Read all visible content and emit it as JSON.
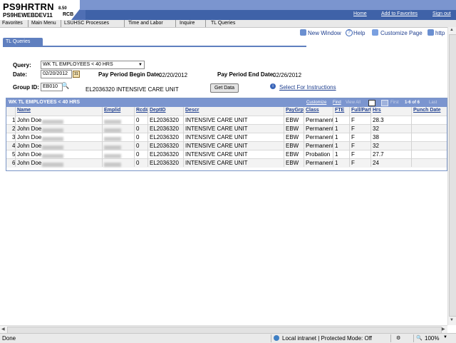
{
  "header": {
    "app_title": "PS9HRTRN",
    "app_version": "8.50",
    "db_name": "PS9HEWEBDEV11",
    "user_id": "RCB",
    "links": [
      "Home",
      "Add to Favorites",
      "Sign out"
    ]
  },
  "nav": {
    "items": [
      "Favorites",
      "Main Menu",
      "LSUHSC Processes",
      "Time and Labor",
      "Inquire",
      "TL Queries"
    ]
  },
  "toolbar": {
    "new_window": "New Window",
    "help": "Help",
    "customize_page": "Customize Page",
    "http": "http"
  },
  "tab": {
    "label": "TL Queries"
  },
  "form": {
    "query_label": "Query:",
    "query_value": "WK TL EMPLOYEES < 40 HRS",
    "date_label": "Date:",
    "date_value": "02/20/2012",
    "calendar_label": "31",
    "begin_label": "Pay Period Begin Date:",
    "begin_value": "02/20/2012",
    "end_label": "Pay Period End Date:",
    "end_value": "02/26/2012",
    "group_label": "Group ID:",
    "group_value": "EB010",
    "group_desc": "EL2036320 INTENSIVE CARE UNIT",
    "get_data": "Get Data",
    "instructions_link": "Select For Instructions"
  },
  "grid": {
    "title": "WK TL EMPLOYEES < 40 HRS",
    "customize": "Customize",
    "find": "Find",
    "view_all": "View All",
    "first": "First",
    "range": "1-6 of 6",
    "last": "Last",
    "columns": [
      "Name",
      "Emplid",
      "Rcd#",
      "DeptID",
      "Descr",
      "PayGrp",
      "Class",
      "FTE",
      "Full/Part",
      "Hrs",
      "Punch Date"
    ],
    "rows": [
      {
        "num": "1",
        "name": "John Doe",
        "rcd": "0",
        "dept": "EL2036320",
        "descr": "INTENSIVE CARE UNIT",
        "paygrp": "EBW",
        "class": "Permanent",
        "fte": "1",
        "fullpart": "F",
        "hrs": "28.3"
      },
      {
        "num": "2",
        "name": "John Doe",
        "rcd": "0",
        "dept": "EL2036320",
        "descr": "INTENSIVE CARE UNIT",
        "paygrp": "EBW",
        "class": "Permanent",
        "fte": "1",
        "fullpart": "F",
        "hrs": "32"
      },
      {
        "num": "3",
        "name": "John Doe",
        "rcd": "0",
        "dept": "EL2036320",
        "descr": "INTENSIVE CARE UNIT",
        "paygrp": "EBW",
        "class": "Permanent",
        "fte": "1",
        "fullpart": "F",
        "hrs": "38"
      },
      {
        "num": "4",
        "name": "John Doe",
        "rcd": "0",
        "dept": "EL2036320",
        "descr": "INTENSIVE CARE UNIT",
        "paygrp": "EBW",
        "class": "Permanent",
        "fte": "1",
        "fullpart": "F",
        "hrs": "32"
      },
      {
        "num": "5",
        "name": "John Doe",
        "rcd": "0",
        "dept": "EL2036320",
        "descr": "INTENSIVE CARE UNIT",
        "paygrp": "EBW",
        "class": "Probation",
        "fte": "1",
        "fullpart": "F",
        "hrs": "27.7"
      },
      {
        "num": "6",
        "name": "John Doe",
        "rcd": "0",
        "dept": "EL2036320",
        "descr": "INTENSIVE CARE UNIT",
        "paygrp": "EBW",
        "class": "Permanent",
        "fte": "1",
        "fullpart": "F",
        "hrs": "24"
      }
    ]
  },
  "status": {
    "left": "Done",
    "zone": "Local intranet | Protected Mode: Off",
    "zoom": "100%"
  }
}
